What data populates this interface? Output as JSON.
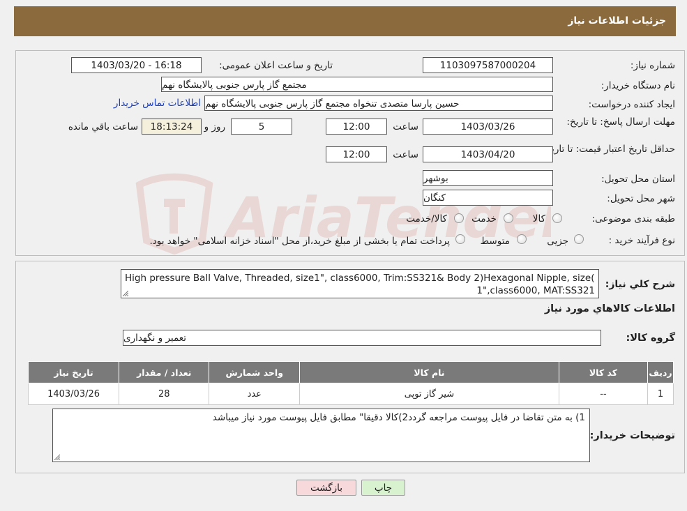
{
  "header": {
    "title": "جزئیات اطلاعات نیاز"
  },
  "form": {
    "need_number_label": "شماره نیاز:",
    "need_number": "1103097587000204",
    "announce_label": "تاریخ و ساعت اعلان عمومی:",
    "announce_value": "1403/03/20 - 16:18",
    "buyer_org_label": "نام دستگاه خریدار:",
    "buyer_org": "مجتمع گاز پارس جنوبی  پالایشگاه نهم",
    "requester_label": "ایجاد کننده درخواست:",
    "requester": "حسین پارسا متصدی تنخواه مجتمع گاز پارس جنوبی  پالایشگاه نهم",
    "buyer_contact_link": "اطلاعات تماس خریدار",
    "deadline_label": "مهلت ارسال پاسخ: تا تاریخ:",
    "deadline_date": "1403/03/26",
    "time_label": "ساعت",
    "deadline_time": "12:00",
    "days_value": "5",
    "days_label": "روز و",
    "remaining_time": "18:13:24",
    "remaining_label": "ساعت باقي مانده",
    "validity_label": "حداقل تاریخ اعتبار قیمت: تا تاریخ:",
    "validity_date": "1403/04/20",
    "validity_time": "12:00",
    "province_label": "استان محل تحویل:",
    "province": "بوشهر",
    "city_label": "شهر محل تحویل:",
    "city": "کنگان",
    "category_label": "طبقه بندی موضوعی:",
    "category_options": [
      "کالا",
      "خدمت",
      "کالا/خدمت"
    ],
    "purchase_type_label": "نوع فرآیند خرید :",
    "purchase_options": [
      "جزیی",
      "متوسط"
    ],
    "purchase_note": "پرداخت تمام یا بخشی از مبلغ خرید،از محل \"اسناد خزانه اسلامی\" خواهد بود."
  },
  "details": {
    "description_label": "شرح کلي نياز:",
    "description_line1": "High pressure Ball Valve, Threaded, size1\", class6000, Trim:SS321& Body 2)Hexagonal Nipple, size(1",
    "description_line2": "1\",class6000, MAT:SS321",
    "goods_info_title": "اطلاعات کالاهاي مورد نياز",
    "goods_group_label": "گروه کالا:",
    "goods_group": "تعمیر و نگهداری",
    "table": {
      "headers": [
        "رديف",
        "کد کالا",
        "نام کالا",
        "واحد شمارش",
        "تعداد / مقدار",
        "تاريخ نياز"
      ],
      "rows": [
        [
          "1",
          "--",
          "شیر گاز توپی",
          "عدد",
          "28",
          "1403/03/26"
        ]
      ]
    },
    "buyer_notes_label": "توضیحات خریدار:",
    "buyer_notes": "1) به متن تقاضا در فایل پیوست مراجعه گردد2)کالا دقیقا\" مطابق فایل پیوست مورد نیاز میباشد"
  },
  "buttons": {
    "print": "چاپ",
    "back": "بازگشت"
  },
  "watermark": {
    "text": "AriaTender.neT"
  },
  "colors": {
    "header_bg": "#8b6a3e",
    "link": "#1a3fc4",
    "back_button_bg": "#f7d9dc",
    "print_button_bg": "#d8f2d0"
  }
}
